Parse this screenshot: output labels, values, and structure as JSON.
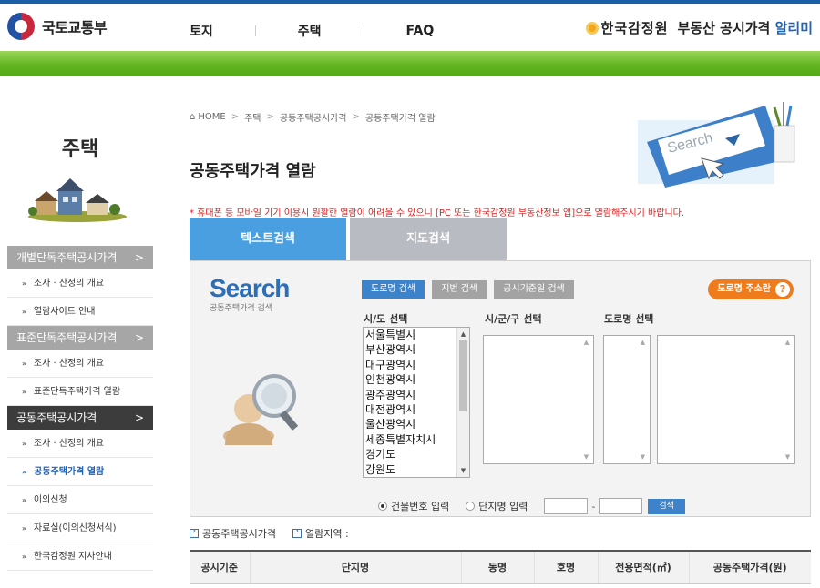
{
  "header": {
    "logo_text": "국토교통부",
    "nav": [
      "토지",
      "주택",
      "FAQ"
    ],
    "brand_name": "한국감정원",
    "brand_title": "부동산 공시가격",
    "brand_highlight": "알리미"
  },
  "sidebar": {
    "title": "주택",
    "groups": [
      {
        "label": "개별단독주택공시가격",
        "arrow": ">",
        "items": [
          "조사 · 산정의 개요",
          "열람사이트 안내"
        ]
      },
      {
        "label": "표준단독주택공시가격",
        "arrow": ">",
        "items": [
          "조사 · 산정의 개요",
          "표준단독주택가격 열람"
        ]
      },
      {
        "label": "공동주택공시가격",
        "arrow": ">",
        "items": [
          "조사 · 산정의 개요",
          "공동주택가격 열람",
          "이의신청",
          "자료실(이의신청서식)",
          "한국감정원 지사안내"
        ]
      }
    ]
  },
  "breadcrumb": [
    "HOME",
    "주택",
    "공동주택공시가격",
    "공동주택가격 열람"
  ],
  "page_title": "공동주택가격 열람",
  "notice": "* 휴대폰 등 모바일 기기 이용시 원활한 열람이 어려울 수 있으니 [PC 또는 한국감정원 부동산정보 앱]으로 열람해주시기 바랍니다.",
  "hero_word": "Search",
  "tabs": [
    "텍스트검색",
    "지도검색"
  ],
  "search": {
    "heading": "Search",
    "subheading": "공동주택가격 검색",
    "mode_buttons": [
      "도로명 검색",
      "지번 검색",
      "공시기준일 검색"
    ],
    "road_help": "도로명 주소란",
    "road_help_icon": "?",
    "labels": {
      "sido": "시/도 선택",
      "sigungu": "시/군/구 선택",
      "road": "도로명 선택"
    },
    "sido_options": [
      "서울특별시",
      "부산광역시",
      "대구광역시",
      "인천광역시",
      "광주광역시",
      "대전광역시",
      "울산광역시",
      "세종특별자치시",
      "경기도",
      "강원도"
    ],
    "radio": [
      "건물번호 입력",
      "단지명 입력"
    ],
    "dash": "-",
    "go_button": "검색"
  },
  "info": {
    "item1": "공동주택공시가격",
    "item2": "열람지역 :"
  },
  "table_headers": [
    "공시기준",
    "단지명",
    "동명",
    "호명",
    "전용면적(㎡)",
    "공동주택가격(원)"
  ],
  "colors": {
    "primary": "#3c83cc",
    "green": "#62b520",
    "accent": "#ef7b1a",
    "notice": "#e01e1e"
  }
}
